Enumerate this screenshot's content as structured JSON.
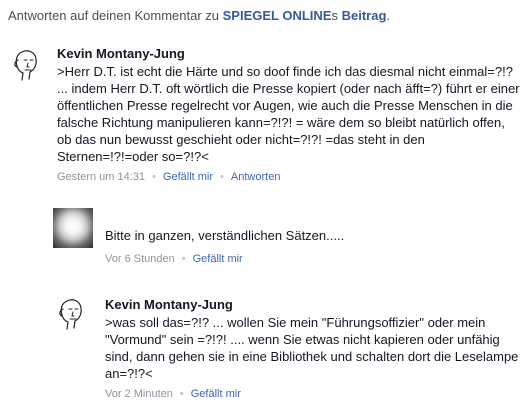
{
  "header": {
    "prefix": "Antworten auf deinen Kommentar zu ",
    "page_link": "SPIEGEL ONLINE",
    "possessive": "s ",
    "post_link": "Beitrag",
    "suffix": "."
  },
  "comments": [
    {
      "author": "Kevin Montany-Jung",
      "avatar_icon": "sketch-face-icon",
      "text": ">Herr D.T. ist echt die Härte und so doof finde ich das diesmal nicht einmal=?!?  ...  indem Herr D.T. oft wörtlich die Presse kopiert (oder nach äfft=?) führt er einer öffentlichen Presse regelrecht vor Augen, wie auch die Presse Menschen in die falsche Richtung manipulieren kann=?!?! = wäre dem so bleibt natürlich offen, ob das nun bewusst geschieht oder nicht=?!?! =das steht in den Sternen=!?!=oder so=?!?<",
      "time": "Gestern um 14:31",
      "like_label": "Gefällt mir",
      "reply_label": "Antworten"
    },
    {
      "author": "",
      "avatar_icon": "photo-avatar-icon",
      "text": "Bitte in ganzen, verständlichen Sätzen.....",
      "time": "Vor 6 Stunden",
      "like_label": "Gefällt mir"
    },
    {
      "author": "Kevin Montany-Jung",
      "avatar_icon": "sketch-face-icon",
      "text": ">was soll das=?!?  ... wollen Sie mein \"Führungsoffizier\" oder mein \"Vormund\"  sein =?!?! .... wenn Sie etwas nicht kapieren oder unfähig sind, dann gehen sie in eine Bibliothek und schalten dort die Leselampe an=?!?<",
      "time": "Vor 2 Minuten",
      "like_label": "Gefällt mir"
    }
  ],
  "colors": {
    "link": "#3b5998",
    "action": "#4267b2",
    "meta": "#90949c",
    "text": "#141823"
  }
}
